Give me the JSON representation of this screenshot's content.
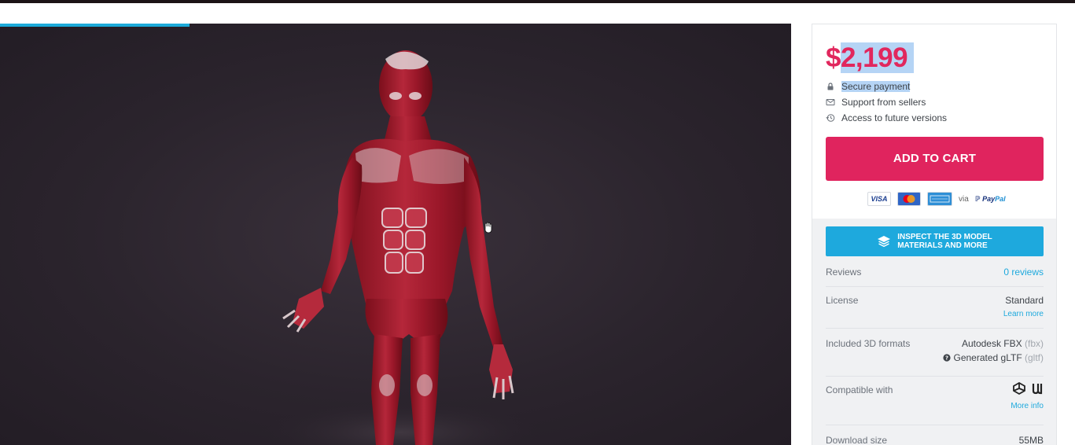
{
  "viewer": {
    "loading_progress": 0.24
  },
  "buy": {
    "price_symbol": "$",
    "price_amount": "2,199",
    "features": [
      {
        "icon": "lock-icon",
        "label": "Secure payment"
      },
      {
        "icon": "envelope-icon",
        "label": "Support from sellers"
      },
      {
        "icon": "history-icon",
        "label": "Access to future versions"
      }
    ],
    "add_to_cart": "ADD TO CART",
    "payment": {
      "visa": "VISA",
      "via": "via",
      "paypal_a": "Pay",
      "paypal_b": "Pal"
    }
  },
  "inspect": {
    "line1": "INSPECT THE 3D MODEL",
    "line2": "MATERIALS AND MORE"
  },
  "details": {
    "reviews_label": "Reviews",
    "reviews_value": "0 reviews",
    "license_label": "License",
    "license_value": "Standard",
    "license_link": "Learn more",
    "formats_label": "Included 3D formats",
    "format1_name": "Autodesk FBX",
    "format1_ext": "(fbx)",
    "format2_name": "Generated gLTF",
    "format2_ext": "(gltf)",
    "compatible_label": "Compatible with",
    "compatible_link": "More info",
    "download_label": "Download size",
    "download_value": "55MB"
  },
  "colors": {
    "accent": "#e0245e",
    "link": "#1ea9dd",
    "viewer_bg": "#2b242d"
  }
}
